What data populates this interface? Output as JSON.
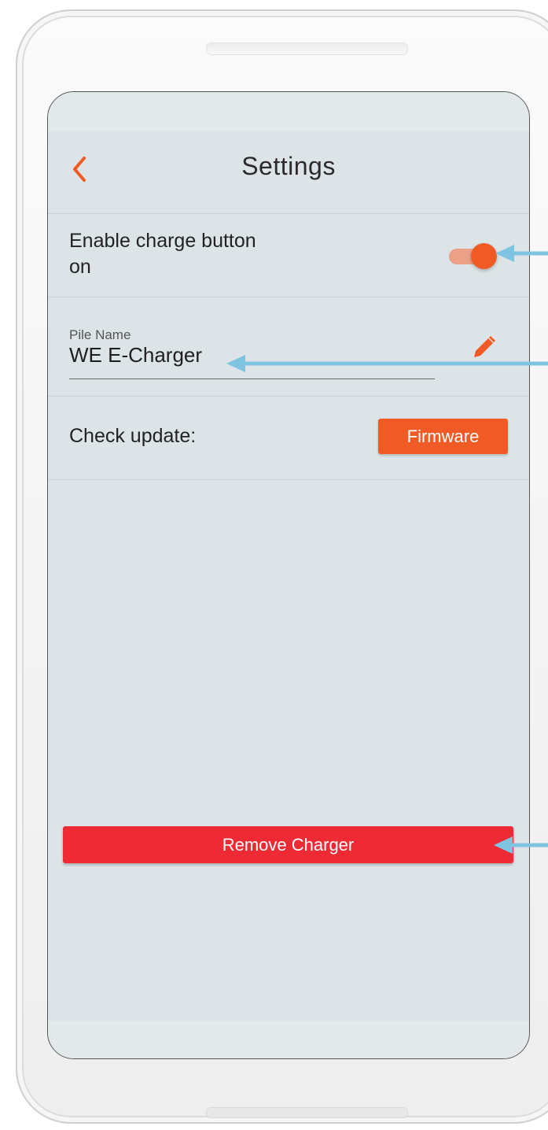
{
  "header": {
    "title": "Settings",
    "back_icon": "chevron-left-icon"
  },
  "toggle_row": {
    "label": "Enable charge button on",
    "enabled": true
  },
  "pile_name": {
    "label": "Pile Name",
    "value": "WE E-Charger",
    "edit_icon": "pencil-icon"
  },
  "update_row": {
    "label": "Check update:",
    "button_label": "Firmware"
  },
  "remove_button": {
    "label": "Remove Charger"
  },
  "colors": {
    "accent": "#f05a24",
    "danger": "#ee2a34",
    "annotation_arrow": "#7ec4e0",
    "screen_bg": "#dde4e7"
  }
}
